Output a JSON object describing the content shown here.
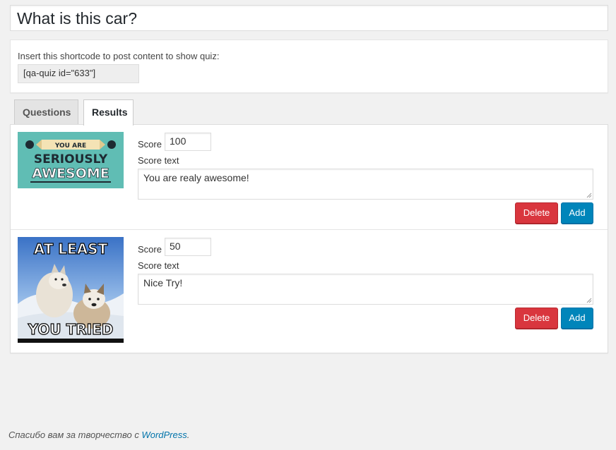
{
  "quiz_title": "What is this car?",
  "shortcode": {
    "label": "Insert this shortcode to post content to show quiz:",
    "value": "[qa-quiz id=\"633\"]"
  },
  "tabs": [
    {
      "label": "Questions",
      "active": false
    },
    {
      "label": "Results",
      "active": true
    }
  ],
  "results": [
    {
      "image_caption_top": "YOU ARE",
      "image_caption_mid": "SERIOUSLY",
      "image_caption_bottom": "AWESOME",
      "score_label": "Score",
      "score": "100",
      "score_text_label": "Score text",
      "score_text": "You are realy awesome!",
      "delete_label": "Delete",
      "add_label": "Add"
    },
    {
      "image_caption_top": "AT LEAST",
      "image_caption_bottom": "YOU TRIED",
      "score_label": "Score",
      "score": "50",
      "score_text_label": "Score text",
      "score_text": "Nice Try!",
      "delete_label": "Delete",
      "add_label": "Add"
    }
  ],
  "footer": {
    "text": "Спасибо вам за творчество с ",
    "link": "WordPress",
    "suffix": "."
  },
  "colors": {
    "delete": "#d9363e",
    "add": "#0085ba",
    "link": "#0073aa"
  }
}
